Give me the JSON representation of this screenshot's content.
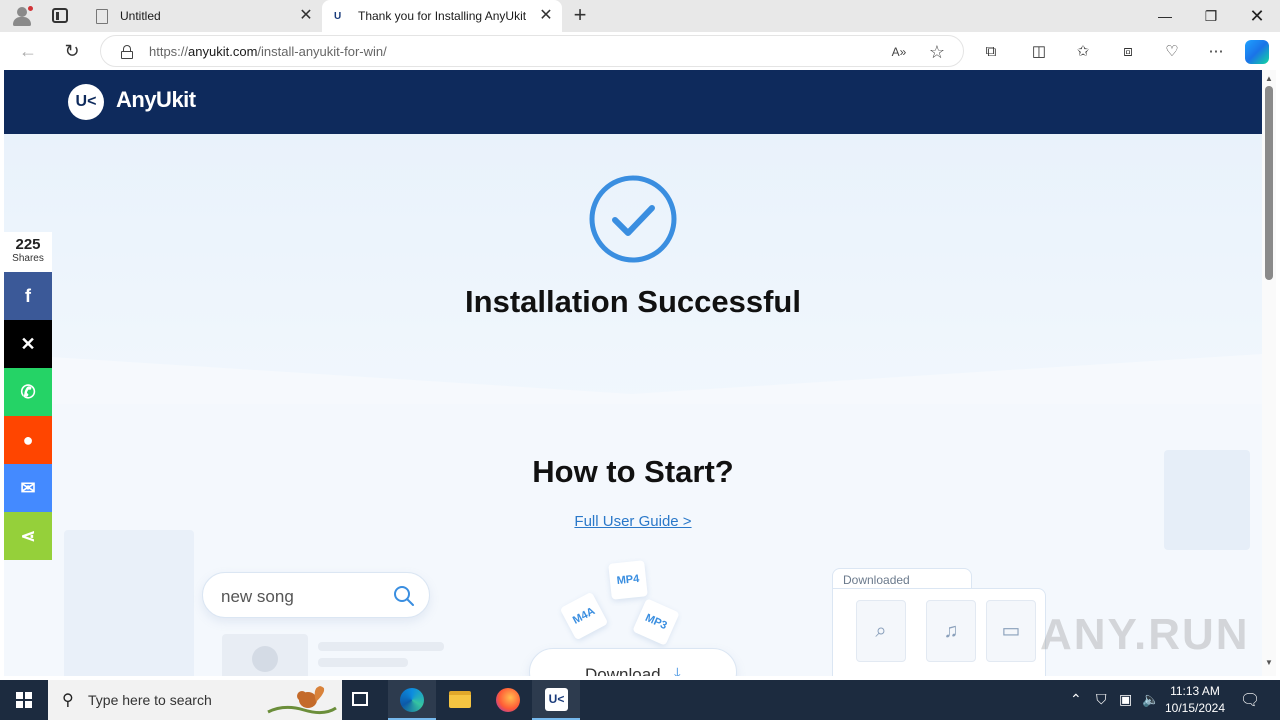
{
  "browser": {
    "tabs": [
      {
        "title": "Untitled",
        "icon": "document-icon",
        "active": false
      },
      {
        "title": "Thank you for Installing AnyUkit",
        "icon": "anyukit-favicon",
        "active": true
      }
    ],
    "address": {
      "scheme": "https://",
      "host": "anyukit.com",
      "path": "/install-anyukit-for-win/"
    }
  },
  "site": {
    "brand": "AnyUkit",
    "logo_mark": "U<",
    "hero_title": "Installation Successful",
    "start_title": "How to Start?",
    "guide_link": "Full User Guide >",
    "search_demo": {
      "query": "new song"
    },
    "formats": [
      "MP4",
      "M4A",
      "MP3"
    ],
    "download_label": "Download",
    "folder_label": "Downloaded"
  },
  "share": {
    "count": "225",
    "label": "Shares",
    "buttons": [
      {
        "network": "facebook",
        "glyph": "f",
        "color": "#3b5998"
      },
      {
        "network": "x",
        "glyph": "𝕏",
        "color": "#000000"
      },
      {
        "network": "whatsapp",
        "glyph": "✆",
        "color": "#25d366"
      },
      {
        "network": "reddit",
        "glyph": "●",
        "color": "#ff4500"
      },
      {
        "network": "messenger",
        "glyph": "✉",
        "color": "#448aff"
      },
      {
        "network": "sharethis",
        "glyph": "⋖",
        "color": "#95d03a"
      }
    ]
  },
  "watermark": "ANY.RUN",
  "taskbar": {
    "search_placeholder": "Type here to search",
    "time": "11:13 AM",
    "date": "10/15/2024"
  },
  "colors": {
    "header_navy": "#0e2a5c",
    "accent_blue": "#3a8ee0",
    "link_blue": "#2a78c9"
  }
}
